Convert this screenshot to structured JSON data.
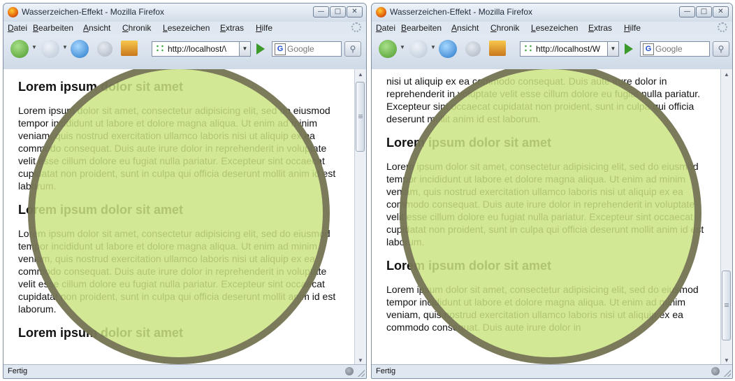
{
  "windows": [
    {
      "title": "Wasserzeichen-Effekt - Mozilla Firefox",
      "menu": [
        "Datei",
        "Bearbeiten",
        "Ansicht",
        "Chronik",
        "Lesezeichen",
        "Extras",
        "Hilfe"
      ],
      "url": "http://localhost/\\",
      "search_placeholder": "Google",
      "status": "Fertig",
      "content": [
        {
          "heading": "Lorem ipsum dolor sit amet",
          "text": "Lorem ipsum dolor sit amet, consectetur adipisicing elit, sed do eiusmod tempor incididunt ut labore et dolore magna aliqua. Ut enim ad minim veniam, quis nostrud exercitation ullamco laboris nisi ut aliquip ex ea commodo consequat. Duis aute irure dolor in reprehenderit in voluptate velit esse cillum dolore eu fugiat nulla pariatur. Excepteur sint occaecat cupidatat non proident, sunt in culpa qui officia deserunt mollit anim id est laborum."
        },
        {
          "heading": "Lorem ipsum dolor sit amet",
          "text": "Lorem ipsum dolor sit amet, consectetur adipisicing elit, sed do eiusmod tempor incididunt ut labore et dolore magna aliqua. Ut enim ad minim veniam, quis nostrud exercitation ullamco laboris nisi ut aliquip ex ea commodo consequat. Duis aute irure dolor in reprehenderit in voluptate velit esse cillum dolore eu fugiat nulla pariatur. Excepteur sint occaecat cupidatat non proident, sunt in culpa qui officia deserunt mollit anim id est laborum."
        },
        {
          "heading": "Lorem ipsum dolor sit amet"
        }
      ]
    },
    {
      "title": "Wasserzeichen-Effekt - Mozilla Firefox",
      "menu": [
        "Datei",
        "Bearbeiten",
        "Ansicht",
        "Chronik",
        "Lesezeichen",
        "Extras",
        "Hilfe"
      ],
      "url": "http://localhost/W",
      "search_placeholder": "Google",
      "status": "Fertig",
      "content": [
        {
          "text": "nisi ut aliquip ex ea commodo consequat. Duis aute irure dolor in reprehenderit in voluptate velit esse cillum dolore eu fugiat nulla pariatur. Excepteur sint occaecat cupidatat non proident, sunt in culpa qui officia deserunt mollit anim id est laborum."
        },
        {
          "heading": "Lorem ipsum dolor sit amet",
          "text": "Lorem ipsum dolor sit amet, consectetur adipisicing elit, sed do eiusmod tempor incididunt ut labore et dolore magna aliqua. Ut enim ad minim veniam, quis nostrud exercitation ullamco laboris nisi ut aliquip ex ea commodo consequat. Duis aute irure dolor in reprehenderit in voluptate velit esse cillum dolore eu fugiat nulla pariatur. Excepteur sint occaecat cupidatat non proident, sunt in culpa qui officia deserunt mollit anim id est laborum."
        },
        {
          "heading": "Lorem ipsum dolor sit amet",
          "text": "Lorem ipsum dolor sit amet, consectetur adipisicing elit, sed do eiusmod tempor incididunt ut labore et dolore magna aliqua. Ut enim ad minim veniam, quis nostrud exercitation ullamco laboris nisi ut aliquip ex ea commodo consequat. Duis aute irure dolor in"
        }
      ]
    }
  ],
  "colors": {
    "watermark_fill": "#cbe482",
    "watermark_ring": "#5f5548"
  }
}
